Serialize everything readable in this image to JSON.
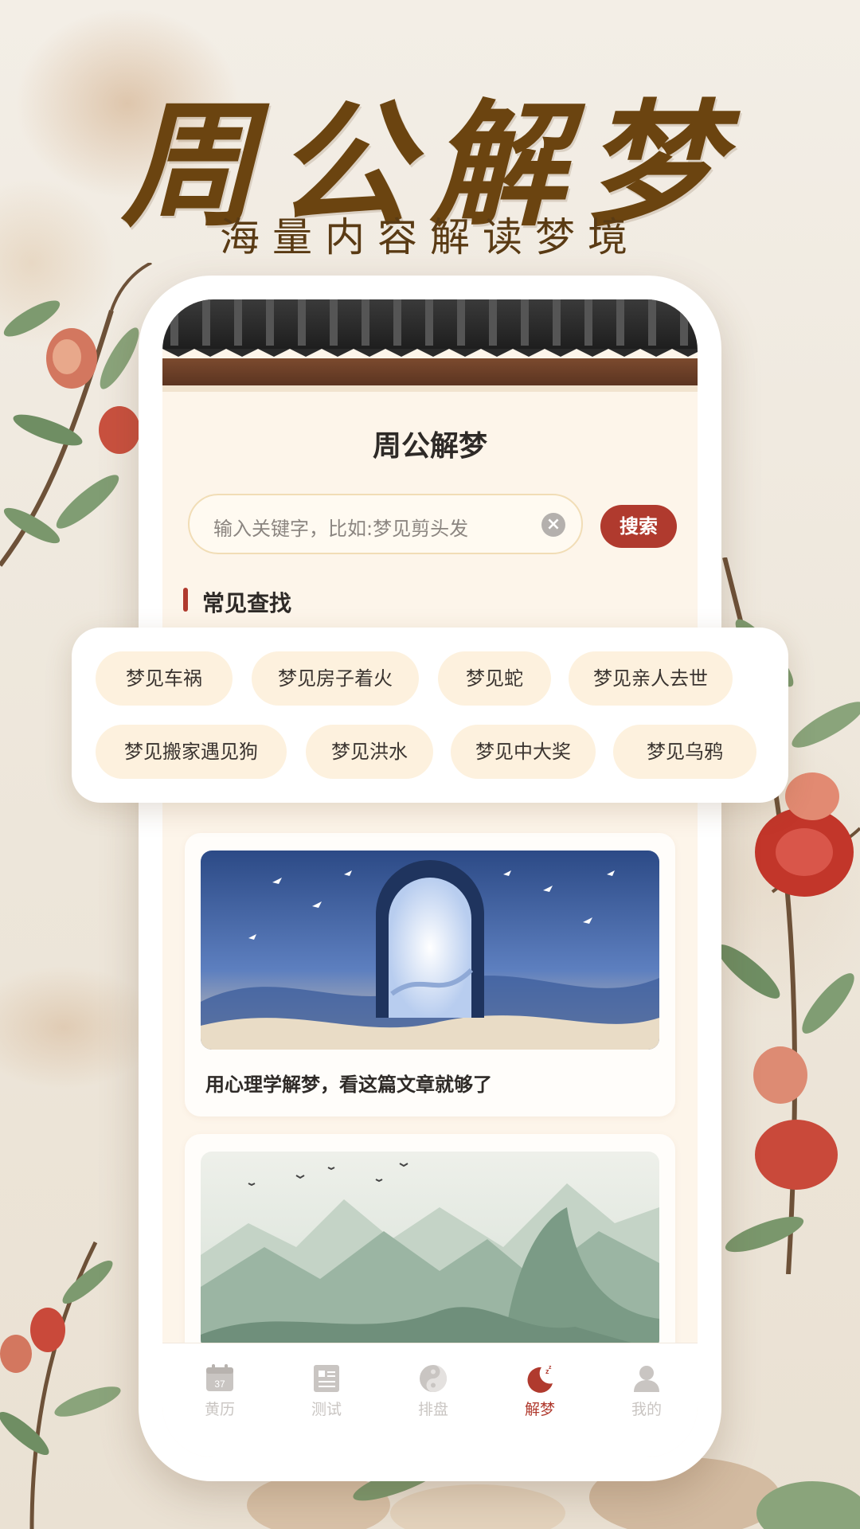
{
  "hero": {
    "title": "周公解梦",
    "subtitle": "海量内容解读梦境"
  },
  "app": {
    "title": "周公解梦",
    "search": {
      "placeholder": "输入关键字，比如:梦见剪头发",
      "clear_icon": "close-circle-icon",
      "button_label": "搜索"
    },
    "section_title": "常见查找",
    "popular_searches": [
      "梦见车祸",
      "梦见房子着火",
      "梦见蛇",
      "梦见亲人去世",
      "梦见搬家遇见狗",
      "梦见洪水",
      "梦见中大奖",
      "梦见乌鸦"
    ],
    "articles": [
      {
        "title": "用心理学解梦，看这篇文章就够了",
        "image": "dream-portal-illustration"
      },
      {
        "title": "",
        "image": "misty-mountains-illustration"
      }
    ],
    "tabs": [
      {
        "label": "黄历",
        "icon": "calendar-icon",
        "active": false
      },
      {
        "label": "测试",
        "icon": "document-icon",
        "active": false
      },
      {
        "label": "排盘",
        "icon": "yin-yang-icon",
        "active": false
      },
      {
        "label": "解梦",
        "icon": "moon-sleep-icon",
        "active": true
      },
      {
        "label": "我的",
        "icon": "user-icon",
        "active": false
      }
    ],
    "calendar_icon_day": "37"
  },
  "colors": {
    "accent": "#b03a2e",
    "title_gold": "#6b4410",
    "chip_bg": "#fdf1de",
    "screen_bg": "#fdf5ea"
  }
}
